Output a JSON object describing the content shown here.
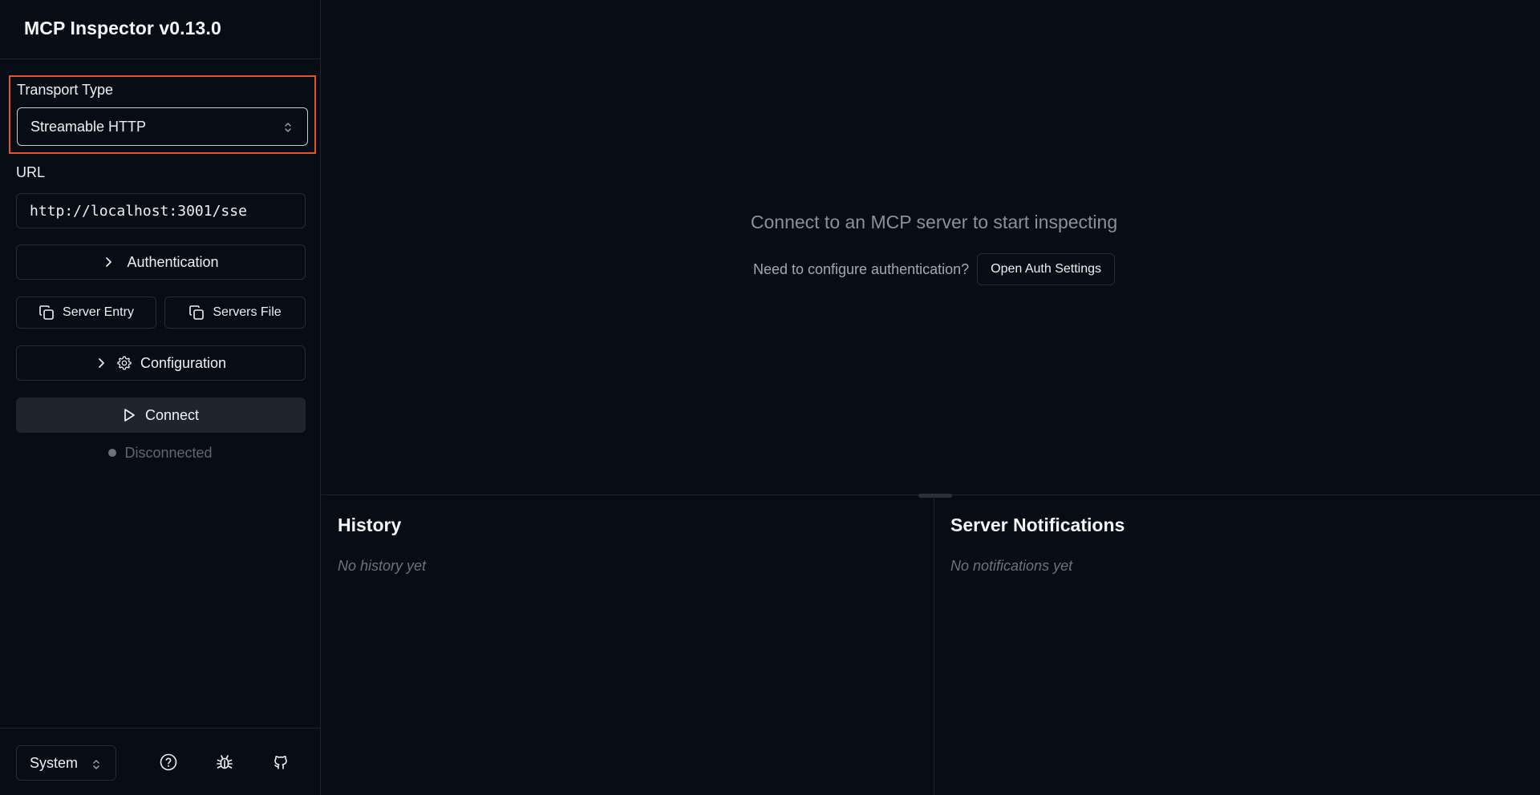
{
  "app": {
    "title": "MCP Inspector v0.13.0"
  },
  "sidebar": {
    "transport": {
      "label": "Transport Type",
      "value": "Streamable HTTP"
    },
    "url": {
      "label": "URL",
      "value": "http://localhost:3001/sse"
    },
    "authentication_label": "Authentication",
    "server_entry_label": "Server Entry",
    "servers_file_label": "Servers File",
    "configuration_label": "Configuration",
    "connect_label": "Connect",
    "status": "Disconnected",
    "footer": {
      "theme_value": "System",
      "icons": [
        "help-icon",
        "bug-icon",
        "github-icon"
      ]
    }
  },
  "main": {
    "connect_message": "Connect to an MCP server to start inspecting",
    "auth_question": "Need to configure authentication?",
    "auth_button": "Open Auth Settings",
    "history": {
      "title": "History",
      "empty": "No history yet"
    },
    "notifications": {
      "title": "Server Notifications",
      "empty": "No notifications yet"
    }
  },
  "colors": {
    "background": "#080c15",
    "highlight_border": "#e8531f",
    "connect_button": "#1f242f",
    "status_dot": "#6b7280"
  }
}
